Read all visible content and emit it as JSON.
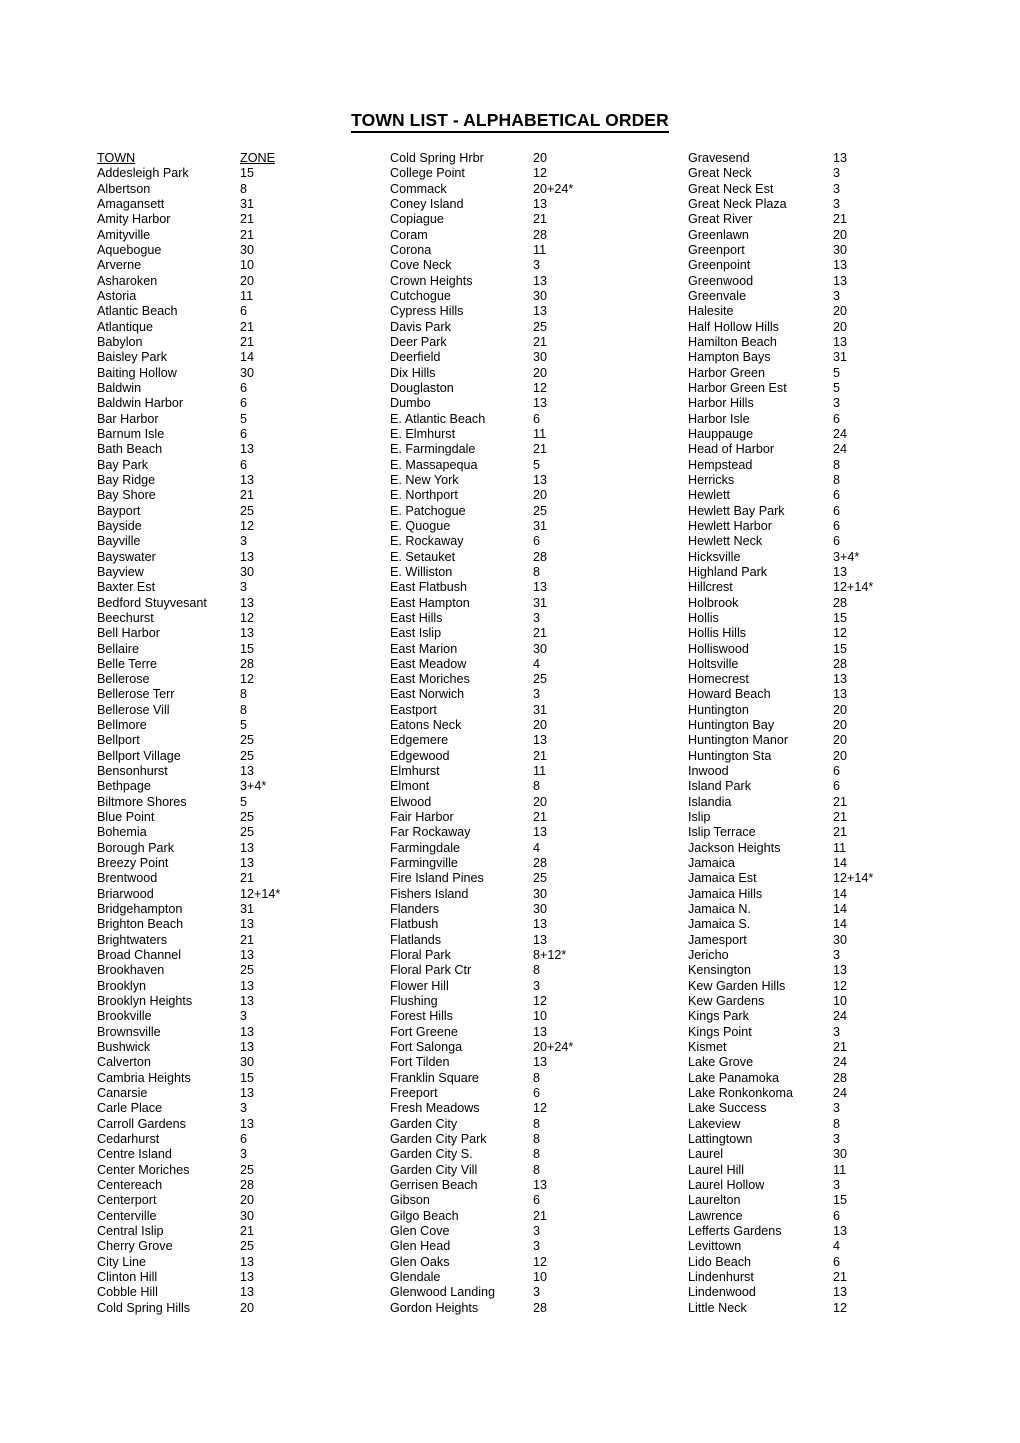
{
  "document": {
    "title": "TOWN LIST - ALPHABETICAL ORDER"
  },
  "table": {
    "headers": {
      "town": "TOWN",
      "zone": "ZONE"
    },
    "columns": [
      {
        "id": "column-1",
        "has_header": true,
        "rows": [
          {
            "town": "Addesleigh Park",
            "zone": "15"
          },
          {
            "town": "Albertson",
            "zone": "8"
          },
          {
            "town": "Amagansett",
            "zone": "31"
          },
          {
            "town": "Amity Harbor",
            "zone": "21"
          },
          {
            "town": "Amityville",
            "zone": "21"
          },
          {
            "town": "Aquebogue",
            "zone": "30"
          },
          {
            "town": "Arverne",
            "zone": "10"
          },
          {
            "town": "Asharoken",
            "zone": "20"
          },
          {
            "town": "Astoria",
            "zone": "11"
          },
          {
            "town": "Atlantic Beach",
            "zone": "6"
          },
          {
            "town": "Atlantique",
            "zone": "21"
          },
          {
            "town": "Babylon",
            "zone": "21"
          },
          {
            "town": "Baisley Park",
            "zone": "14"
          },
          {
            "town": "Baiting Hollow",
            "zone": "30"
          },
          {
            "town": "Baldwin",
            "zone": "6"
          },
          {
            "town": "Baldwin Harbor",
            "zone": "6"
          },
          {
            "town": "Bar Harbor",
            "zone": "5"
          },
          {
            "town": "Barnum Isle",
            "zone": "6"
          },
          {
            "town": "Bath Beach",
            "zone": "13"
          },
          {
            "town": "Bay Park",
            "zone": "6"
          },
          {
            "town": "Bay Ridge",
            "zone": "13"
          },
          {
            "town": "Bay Shore",
            "zone": "21"
          },
          {
            "town": "Bayport",
            "zone": "25"
          },
          {
            "town": "Bayside",
            "zone": "12"
          },
          {
            "town": "Bayville",
            "zone": "3"
          },
          {
            "town": "Bayswater",
            "zone": "13"
          },
          {
            "town": "Bayview",
            "zone": "30"
          },
          {
            "town": "Baxter Est",
            "zone": "3"
          },
          {
            "town": "Bedford Stuyvesant",
            "zone": "13"
          },
          {
            "town": "Beechurst",
            "zone": "12"
          },
          {
            "town": "Bell Harbor",
            "zone": "13"
          },
          {
            "town": "Bellaire",
            "zone": "15"
          },
          {
            "town": "Belle Terre",
            "zone": "28"
          },
          {
            "town": "Bellerose",
            "zone": "12"
          },
          {
            "town": "Bellerose Terr",
            "zone": "8"
          },
          {
            "town": "Bellerose Vill",
            "zone": "8"
          },
          {
            "town": "Bellmore",
            "zone": "5"
          },
          {
            "town": "Bellport",
            "zone": "25"
          },
          {
            "town": "Bellport Village",
            "zone": "25"
          },
          {
            "town": "Bensonhurst",
            "zone": "13"
          },
          {
            "town": "Bethpage",
            "zone": "3+4*"
          },
          {
            "town": "Biltmore Shores",
            "zone": "5"
          },
          {
            "town": "Blue Point",
            "zone": "25"
          },
          {
            "town": "Bohemia",
            "zone": "25"
          },
          {
            "town": "Borough Park",
            "zone": "13"
          },
          {
            "town": "Breezy Point",
            "zone": "13"
          },
          {
            "town": "Brentwood",
            "zone": "21"
          },
          {
            "town": "Briarwood",
            "zone": "12+14*"
          },
          {
            "town": "Bridgehampton",
            "zone": "31"
          },
          {
            "town": "Brighton Beach",
            "zone": "13"
          },
          {
            "town": "Brightwaters",
            "zone": "21"
          },
          {
            "town": "Broad Channel",
            "zone": "13"
          },
          {
            "town": "Brookhaven",
            "zone": "25"
          },
          {
            "town": "Brooklyn",
            "zone": "13"
          },
          {
            "town": "Brooklyn Heights",
            "zone": "13"
          },
          {
            "town": "Brookville",
            "zone": "3"
          },
          {
            "town": "Brownsville",
            "zone": "13"
          },
          {
            "town": "Bushwick",
            "zone": "13"
          },
          {
            "town": "Calverton",
            "zone": "30"
          },
          {
            "town": "Cambria Heights",
            "zone": "15"
          },
          {
            "town": "Canarsie",
            "zone": "13"
          },
          {
            "town": "Carle Place",
            "zone": "3"
          },
          {
            "town": "Carroll Gardens",
            "zone": "13"
          },
          {
            "town": "Cedarhurst",
            "zone": "6"
          },
          {
            "town": "Centre Island",
            "zone": "3"
          },
          {
            "town": "Center Moriches",
            "zone": "25"
          },
          {
            "town": "Centereach",
            "zone": "28"
          },
          {
            "town": "Centerport",
            "zone": "20"
          },
          {
            "town": "Centerville",
            "zone": "30"
          },
          {
            "town": "Central Islip",
            "zone": "21"
          },
          {
            "town": "Cherry Grove",
            "zone": "25"
          },
          {
            "town": "City Line",
            "zone": "13"
          },
          {
            "town": "Clinton Hill",
            "zone": "13"
          },
          {
            "town": "Cobble Hill",
            "zone": "13"
          },
          {
            "town": "Cold Spring Hills",
            "zone": "20"
          }
        ]
      },
      {
        "id": "column-2",
        "has_header": false,
        "rows": [
          {
            "town": "Cold Spring Hrbr",
            "zone": "20"
          },
          {
            "town": "College Point",
            "zone": "12"
          },
          {
            "town": "Commack",
            "zone": "20+24*"
          },
          {
            "town": "Coney Island",
            "zone": "13"
          },
          {
            "town": "Copiague",
            "zone": "21"
          },
          {
            "town": "Coram",
            "zone": "28"
          },
          {
            "town": "Corona",
            "zone": "11"
          },
          {
            "town": "Cove Neck",
            "zone": "3"
          },
          {
            "town": "Crown Heights",
            "zone": "13"
          },
          {
            "town": "Cutchogue",
            "zone": "30"
          },
          {
            "town": "Cypress Hills",
            "zone": "13"
          },
          {
            "town": "Davis Park",
            "zone": "25"
          },
          {
            "town": "Deer Park",
            "zone": "21"
          },
          {
            "town": "Deerfield",
            "zone": "30"
          },
          {
            "town": "Dix Hills",
            "zone": "20"
          },
          {
            "town": "Douglaston",
            "zone": "12"
          },
          {
            "town": "Dumbo",
            "zone": "13"
          },
          {
            "town": "E. Atlantic Beach",
            "zone": "6"
          },
          {
            "town": "E. Elmhurst",
            "zone": "11"
          },
          {
            "town": "E. Farmingdale",
            "zone": "21"
          },
          {
            "town": "E. Massapequa",
            "zone": "5"
          },
          {
            "town": "E. New York",
            "zone": "13"
          },
          {
            "town": "E. Northport",
            "zone": "20"
          },
          {
            "town": "E. Patchogue",
            "zone": "25"
          },
          {
            "town": "E. Quogue",
            "zone": "31"
          },
          {
            "town": "E. Rockaway",
            "zone": "6"
          },
          {
            "town": "E. Setauket",
            "zone": "28"
          },
          {
            "town": "E. Williston",
            "zone": "8"
          },
          {
            "town": "East Flatbush",
            "zone": "13"
          },
          {
            "town": "East Hampton",
            "zone": "31"
          },
          {
            "town": "East Hills",
            "zone": "3"
          },
          {
            "town": "East Islip",
            "zone": "21"
          },
          {
            "town": "East Marion",
            "zone": "30"
          },
          {
            "town": "East Meadow",
            "zone": "4"
          },
          {
            "town": "East Moriches",
            "zone": "25"
          },
          {
            "town": "East Norwich",
            "zone": "3"
          },
          {
            "town": "Eastport",
            "zone": "31"
          },
          {
            "town": "Eatons Neck",
            "zone": "20"
          },
          {
            "town": "Edgemere",
            "zone": "13"
          },
          {
            "town": "Edgewood",
            "zone": "21"
          },
          {
            "town": "Elmhurst",
            "zone": "11"
          },
          {
            "town": "Elmont",
            "zone": "8"
          },
          {
            "town": "Elwood",
            "zone": "20"
          },
          {
            "town": "Fair Harbor",
            "zone": "21"
          },
          {
            "town": "Far Rockaway",
            "zone": "13"
          },
          {
            "town": "Farmingdale",
            "zone": "4"
          },
          {
            "town": "Farmingville",
            "zone": "28"
          },
          {
            "town": "Fire Island Pines",
            "zone": "25"
          },
          {
            "town": "Fishers Island",
            "zone": "30"
          },
          {
            "town": "Flanders",
            "zone": "30"
          },
          {
            "town": "Flatbush",
            "zone": "13"
          },
          {
            "town": "Flatlands",
            "zone": "13"
          },
          {
            "town": "Floral Park",
            "zone": "8+12*"
          },
          {
            "town": "Floral Park Ctr",
            "zone": "8"
          },
          {
            "town": "Flower Hill",
            "zone": "3"
          },
          {
            "town": "Flushing",
            "zone": "12"
          },
          {
            "town": "Forest Hills",
            "zone": "10"
          },
          {
            "town": "Fort Greene",
            "zone": "13"
          },
          {
            "town": "Fort Salonga",
            "zone": "20+24*"
          },
          {
            "town": "Fort Tilden",
            "zone": "13"
          },
          {
            "town": "Franklin Square",
            "zone": "8"
          },
          {
            "town": "Freeport",
            "zone": "6"
          },
          {
            "town": "Fresh Meadows",
            "zone": "12"
          },
          {
            "town": "Garden City",
            "zone": "8"
          },
          {
            "town": "Garden City Park",
            "zone": "8"
          },
          {
            "town": "Garden City S.",
            "zone": "8"
          },
          {
            "town": "Garden City Vill",
            "zone": "8"
          },
          {
            "town": "Gerrisen Beach",
            "zone": "13"
          },
          {
            "town": "Gibson",
            "zone": "6"
          },
          {
            "town": "Gilgo Beach",
            "zone": "21"
          },
          {
            "town": "Glen Cove",
            "zone": "3"
          },
          {
            "town": "Glen Head",
            "zone": "3"
          },
          {
            "town": "Glen Oaks",
            "zone": "12"
          },
          {
            "town": "Glendale",
            "zone": "10"
          },
          {
            "town": "Glenwood Landing",
            "zone": "3"
          },
          {
            "town": "Gordon Heights",
            "zone": "28"
          }
        ]
      },
      {
        "id": "column-3",
        "has_header": false,
        "rows": [
          {
            "town": "Gravesend",
            "zone": "13"
          },
          {
            "town": "Great Neck",
            "zone": "3"
          },
          {
            "town": "Great Neck Est",
            "zone": "3"
          },
          {
            "town": "Great Neck Plaza",
            "zone": "3"
          },
          {
            "town": "Great River",
            "zone": "21"
          },
          {
            "town": "Greenlawn",
            "zone": "20"
          },
          {
            "town": "Greenport",
            "zone": "30"
          },
          {
            "town": "Greenpoint",
            "zone": "13"
          },
          {
            "town": "Greenwood",
            "zone": "13"
          },
          {
            "town": "Greenvale",
            "zone": "3"
          },
          {
            "town": "Halesite",
            "zone": "20"
          },
          {
            "town": "Half Hollow Hills",
            "zone": "20"
          },
          {
            "town": "Hamilton Beach",
            "zone": "13"
          },
          {
            "town": "Hampton Bays",
            "zone": "31"
          },
          {
            "town": "Harbor Green",
            "zone": "5"
          },
          {
            "town": "Harbor Green Est",
            "zone": "5"
          },
          {
            "town": "Harbor Hills",
            "zone": "3"
          },
          {
            "town": "Harbor Isle",
            "zone": "6"
          },
          {
            "town": "Hauppauge",
            "zone": "24"
          },
          {
            "town": "Head of Harbor",
            "zone": "24"
          },
          {
            "town": "Hempstead",
            "zone": "8"
          },
          {
            "town": "Herricks",
            "zone": "8"
          },
          {
            "town": "Hewlett",
            "zone": "6"
          },
          {
            "town": "Hewlett Bay Park",
            "zone": "6"
          },
          {
            "town": "Hewlett Harbor",
            "zone": "6"
          },
          {
            "town": "Hewlett Neck",
            "zone": "6"
          },
          {
            "town": "Hicksville",
            "zone": "3+4*"
          },
          {
            "town": "Highland Park",
            "zone": "13"
          },
          {
            "town": "Hillcrest",
            "zone": "12+14*"
          },
          {
            "town": "Holbrook",
            "zone": "28"
          },
          {
            "town": "Hollis",
            "zone": "15"
          },
          {
            "town": "Hollis Hills",
            "zone": "12"
          },
          {
            "town": "Holliswood",
            "zone": "15"
          },
          {
            "town": "Holtsville",
            "zone": "28"
          },
          {
            "town": "Homecrest",
            "zone": "13"
          },
          {
            "town": "Howard Beach",
            "zone": "13"
          },
          {
            "town": "Huntington",
            "zone": "20"
          },
          {
            "town": "Huntington Bay",
            "zone": "20"
          },
          {
            "town": "Huntington Manor",
            "zone": "20"
          },
          {
            "town": "Huntington Sta",
            "zone": "20"
          },
          {
            "town": "Inwood",
            "zone": "6"
          },
          {
            "town": "Island Park",
            "zone": "6"
          },
          {
            "town": "Islandia",
            "zone": "21"
          },
          {
            "town": "Islip",
            "zone": "21"
          },
          {
            "town": "Islip Terrace",
            "zone": "21"
          },
          {
            "town": "Jackson Heights",
            "zone": "11"
          },
          {
            "town": "Jamaica",
            "zone": "14"
          },
          {
            "town": "Jamaica Est",
            "zone": "12+14*"
          },
          {
            "town": "Jamaica Hills",
            "zone": "14"
          },
          {
            "town": "Jamaica N.",
            "zone": "14"
          },
          {
            "town": "Jamaica S.",
            "zone": "14"
          },
          {
            "town": "Jamesport",
            "zone": "30"
          },
          {
            "town": "Jericho",
            "zone": "3"
          },
          {
            "town": "Kensington",
            "zone": "13"
          },
          {
            "town": "Kew Garden Hills",
            "zone": "12"
          },
          {
            "town": "Kew Gardens",
            "zone": "10"
          },
          {
            "town": "Kings Park",
            "zone": "24"
          },
          {
            "town": "Kings Point",
            "zone": "3"
          },
          {
            "town": "Kismet",
            "zone": "21"
          },
          {
            "town": "Lake Grove",
            "zone": "24"
          },
          {
            "town": "Lake Panamoka",
            "zone": "28"
          },
          {
            "town": "Lake Ronkonkoma",
            "zone": "24"
          },
          {
            "town": "Lake Success",
            "zone": "3"
          },
          {
            "town": "Lakeview",
            "zone": "8"
          },
          {
            "town": "Lattingtown",
            "zone": "3"
          },
          {
            "town": "Laurel",
            "zone": "30"
          },
          {
            "town": "Laurel Hill",
            "zone": "11"
          },
          {
            "town": "Laurel Hollow",
            "zone": "3"
          },
          {
            "town": "Laurelton",
            "zone": "15"
          },
          {
            "town": "Lawrence",
            "zone": "6"
          },
          {
            "town": "Lefferts Gardens",
            "zone": "13"
          },
          {
            "town": "Levittown",
            "zone": "4"
          },
          {
            "town": "Lido Beach",
            "zone": "6"
          },
          {
            "town": "Lindenhurst",
            "zone": "21"
          },
          {
            "town": "Lindenwood",
            "zone": "13"
          },
          {
            "town": "Little Neck",
            "zone": "12"
          }
        ]
      }
    ]
  }
}
